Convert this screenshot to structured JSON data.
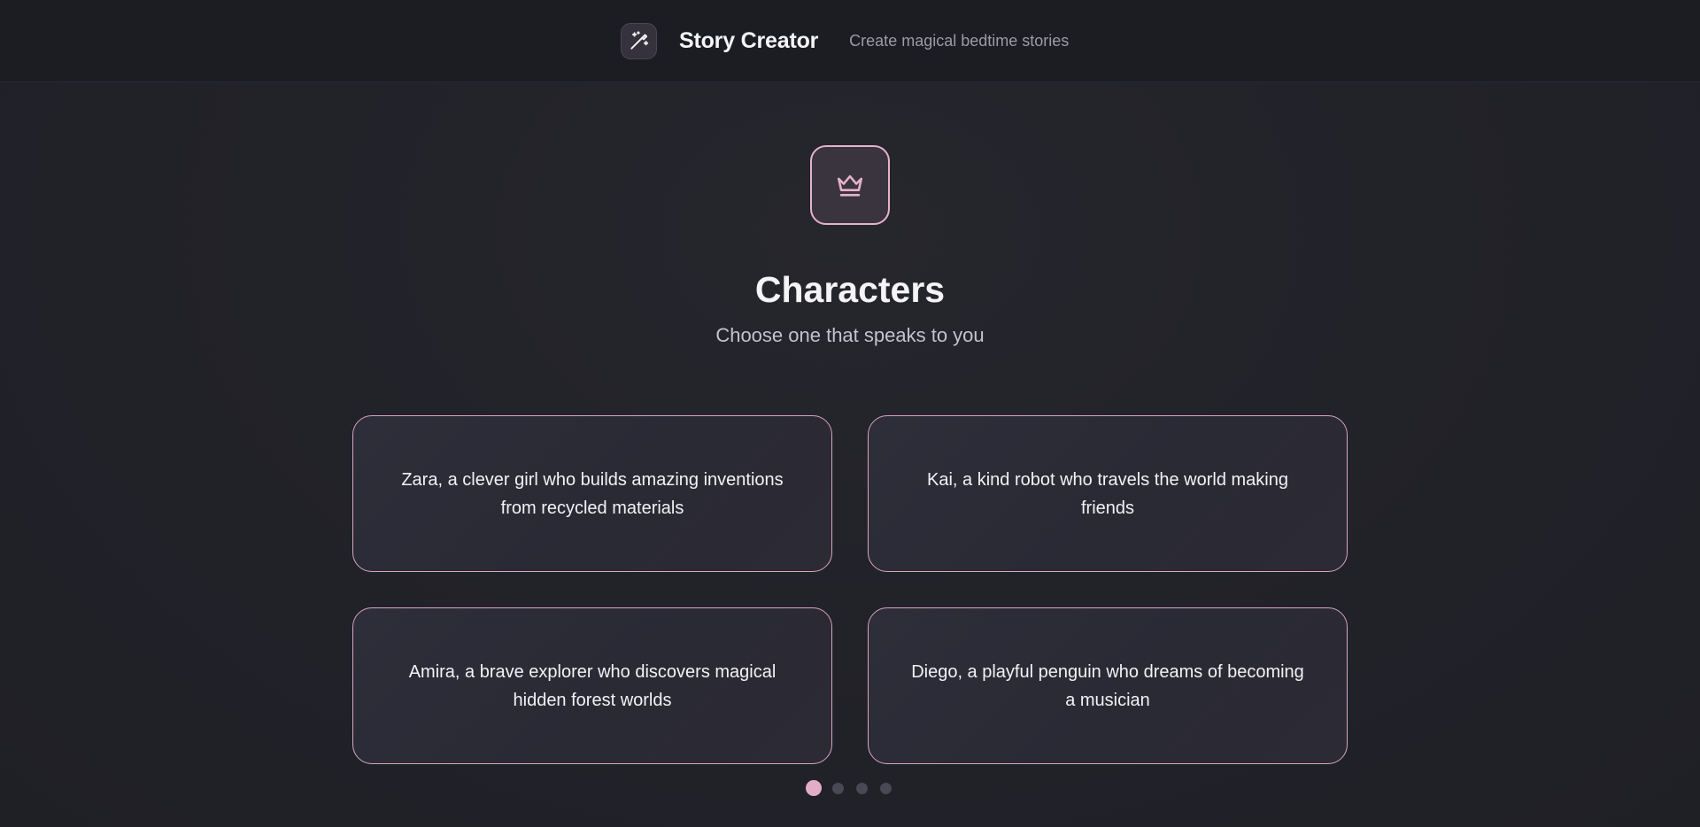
{
  "header": {
    "logo_icon": "magic-wand-icon",
    "title": "Story Creator",
    "subtitle": "Create magical bedtime stories"
  },
  "main": {
    "hero_icon": "crown-icon",
    "title": "Characters",
    "subtitle": "Choose one that speaks to you",
    "cards": [
      {
        "text": "Zara, a clever girl who builds amazing inventions from recycled materials"
      },
      {
        "text": "Kai, a kind robot who travels the world making friends"
      },
      {
        "text": "Amira, a brave explorer who discovers magical hidden forest worlds"
      },
      {
        "text": "Diego, a playful penguin who dreams of becoming a musician"
      }
    ],
    "pagination": {
      "pages": 4,
      "current": 1
    }
  },
  "colors": {
    "accent": "#e2aec5",
    "background": "#212129",
    "card_border": "#d7a6bf"
  }
}
